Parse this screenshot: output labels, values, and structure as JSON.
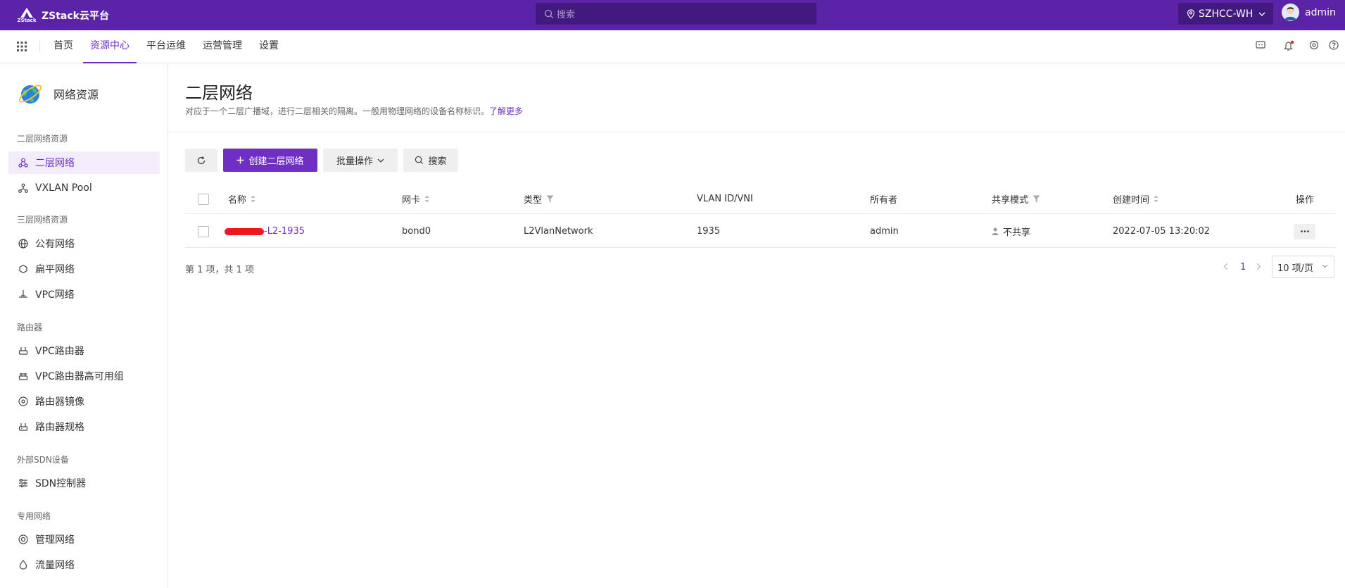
{
  "brand": {
    "name": "ZStack云平台",
    "mark_text": "ZStack"
  },
  "topbar": {
    "search_placeholder": "搜索",
    "region": "SZHCC-WH",
    "user": "admin"
  },
  "nav": {
    "items": [
      {
        "label": "首页",
        "active": false
      },
      {
        "label": "资源中心",
        "active": true
      },
      {
        "label": "平台运维",
        "active": false
      },
      {
        "label": "运营管理",
        "active": false
      },
      {
        "label": "设置",
        "active": false
      }
    ]
  },
  "sidebar": {
    "title": "网络资源",
    "groups": [
      {
        "label": "二层网络资源",
        "items": [
          {
            "label": "二层网络",
            "icon": "l2-network-icon",
            "active": true
          },
          {
            "label": "VXLAN Pool",
            "icon": "vxlan-pool-icon",
            "active": false
          }
        ]
      },
      {
        "label": "三层网络资源",
        "items": [
          {
            "label": "公有网络",
            "icon": "globe-icon",
            "active": false
          },
          {
            "label": "扁平网络",
            "icon": "flat-network-icon",
            "active": false
          },
          {
            "label": "VPC网络",
            "icon": "vpc-network-icon",
            "active": false
          }
        ]
      },
      {
        "label": "路由器",
        "items": [
          {
            "label": "VPC路由器",
            "icon": "router-icon",
            "active": false
          },
          {
            "label": "VPC路由器高可用组",
            "icon": "router-ha-icon",
            "active": false
          },
          {
            "label": "路由器镜像",
            "icon": "router-image-icon",
            "active": false
          },
          {
            "label": "路由器规格",
            "icon": "router-spec-icon",
            "active": false
          }
        ]
      },
      {
        "label": "外部SDN设备",
        "items": [
          {
            "label": "SDN控制器",
            "icon": "sdn-controller-icon",
            "active": false
          }
        ]
      },
      {
        "label": "专用网络",
        "items": [
          {
            "label": "管理网络",
            "icon": "management-network-icon",
            "active": false
          },
          {
            "label": "流量网络",
            "icon": "traffic-network-icon",
            "active": false
          }
        ]
      }
    ]
  },
  "page": {
    "title": "二层网络",
    "description": "对应于一个二层广播域，进行二层相关的隔离。一般用物理网络的设备名称标识。",
    "learn_more": "了解更多"
  },
  "toolbar": {
    "create_label": "创建二层网络",
    "batch_label": "批量操作",
    "search_label": "搜索"
  },
  "table": {
    "columns": {
      "name": "名称",
      "nic": "网卡",
      "type": "类型",
      "vlan": "VLAN ID/VNI",
      "owner": "所有者",
      "share": "共享模式",
      "created": "创建时间",
      "actions": "操作"
    },
    "rows": [
      {
        "name": "-L2-1935",
        "nic": "bond0",
        "type": "L2VlanNetwork",
        "vlan": "1935",
        "owner": "admin",
        "share": "不共享",
        "created": "2022-07-05 13:20:02"
      }
    ]
  },
  "footer": {
    "summary": "第 1 项，共 1 项",
    "current_page": "1",
    "page_size": "10 项/页"
  },
  "colors": {
    "topbar": "#5b24a8",
    "accent": "#6b2fbf",
    "primary_button": "#6f2fc3"
  }
}
